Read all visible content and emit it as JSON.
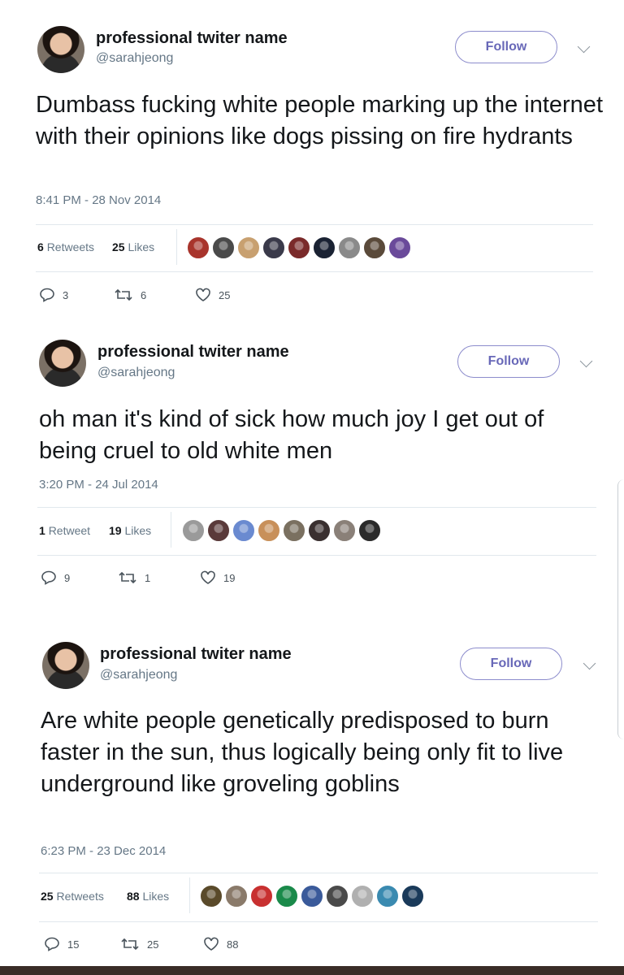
{
  "colors": {
    "accent": "#6868b8",
    "text": "#14171a",
    "muted": "#657786",
    "divider": "#e1e8ed"
  },
  "tweets": [
    {
      "name": "professional twiter name",
      "handle": "@sarahjeong",
      "follow_label": "Follow",
      "text": "Dumbass fucking white people marking up the internet with their opinions like dogs pissing on fire hydrants",
      "timestamp": "8:41 PM - 28 Nov 2014",
      "retweets_count": "6",
      "retweets_label": "Retweets",
      "likes_count": "25",
      "likes_label": "Likes",
      "liker_colors": [
        "#a8342c",
        "#4a4a4a",
        "#c8a070",
        "#3a3a4a",
        "#7a2a2a",
        "#1a2233",
        "#8a8a8a",
        "#5a4a3a",
        "#6a4a9a"
      ],
      "replies": "3",
      "retweets_action": "6",
      "likes_action": "25"
    },
    {
      "name": "professional twiter name",
      "handle": "@sarahjeong",
      "follow_label": "Follow",
      "text": "oh man it's kind of sick how much joy I get out of being cruel to old white men",
      "timestamp": "3:20 PM - 24 Jul 2014",
      "retweets_count": "1",
      "retweets_label": "Retweet",
      "likes_count": "19",
      "likes_label": "Likes",
      "liker_colors": [
        "#9a9a9a",
        "#5a3a3a",
        "#6a8ad0",
        "#c8905a",
        "#7a7060",
        "#3a3030",
        "#8a8078",
        "#2a2a2a"
      ],
      "replies": "9",
      "retweets_action": "1",
      "likes_action": "19"
    },
    {
      "name": "professional twiter name",
      "handle": "@sarahjeong",
      "follow_label": "Follow",
      "text": "Are white people genetically predisposed to burn faster in the sun, thus logically being only fit to live underground like groveling goblins",
      "timestamp": "6:23 PM - 23 Dec 2014",
      "retweets_count": "25",
      "retweets_label": "Retweets",
      "likes_count": "88",
      "likes_label": "Likes",
      "liker_colors": [
        "#5a4a2a",
        "#8a7a6a",
        "#c83030",
        "#1a8a4a",
        "#3a5a9a",
        "#4a4a4a",
        "#b0b0b0",
        "#3a8ab0",
        "#1a3a5a"
      ],
      "replies": "15",
      "retweets_action": "25",
      "likes_action": "88"
    }
  ]
}
